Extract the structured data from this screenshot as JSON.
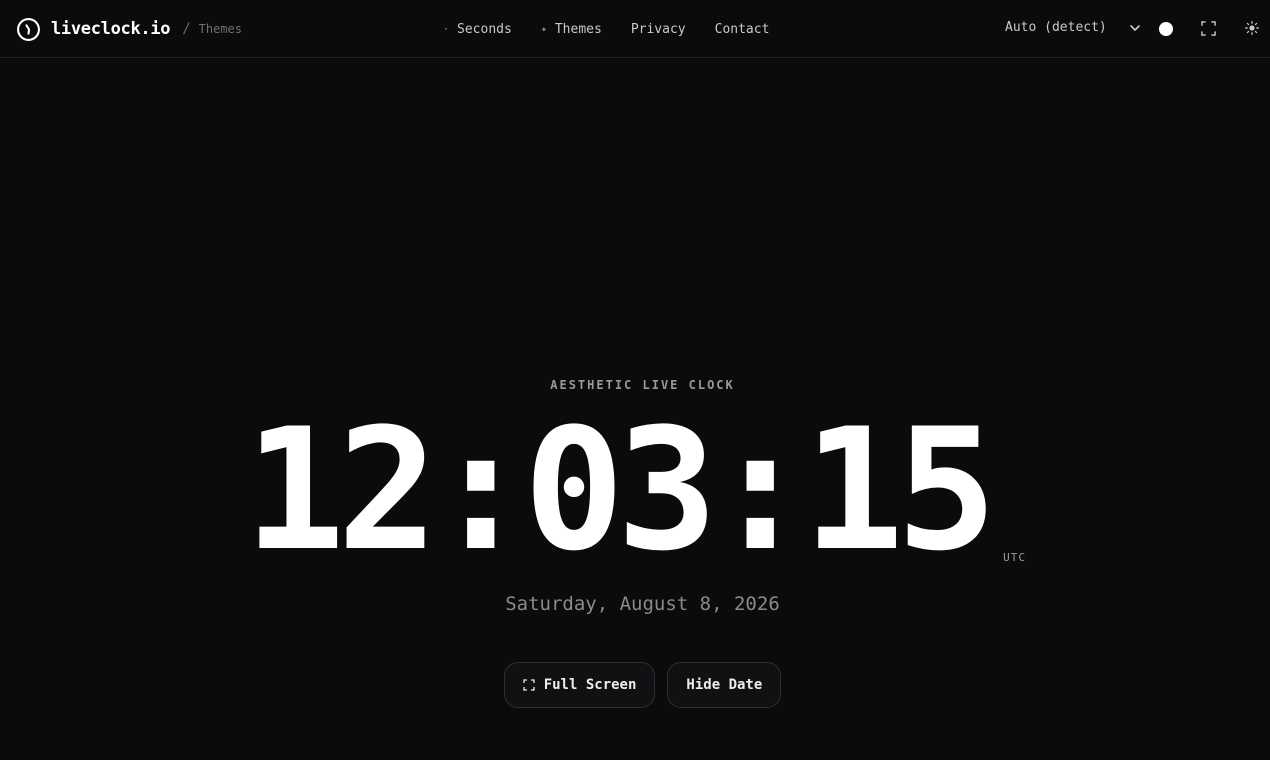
{
  "brand": {
    "name": "liveclock.io",
    "separator": "/",
    "breadcrumb": "Themes",
    "logo_icon": "clock-logo-icon"
  },
  "nav": {
    "items": [
      {
        "glyph": "·",
        "label": "Seconds"
      },
      {
        "glyph": "✦",
        "label": "Themes"
      },
      {
        "glyph": "",
        "label": "Privacy"
      },
      {
        "glyph": "",
        "label": "Contact"
      }
    ]
  },
  "controls": {
    "timezone_selected": "Auto (detect)",
    "icons": [
      "chevron-down-icon",
      "theme-dot-icon",
      "fullscreen-icon",
      "sun-icon"
    ]
  },
  "clock": {
    "eyebrow": "AESTHETIC LIVE CLOCK",
    "time": "12:03:15",
    "timezone": "UTC",
    "date": "Saturday, August 8, 2026"
  },
  "actions": {
    "fullscreen_label": "Full Screen",
    "hide_date_label": "Hide Date"
  },
  "colors": {
    "background": "#0b0b0c",
    "text": "#ffffff",
    "muted": "#8a8a8e"
  }
}
